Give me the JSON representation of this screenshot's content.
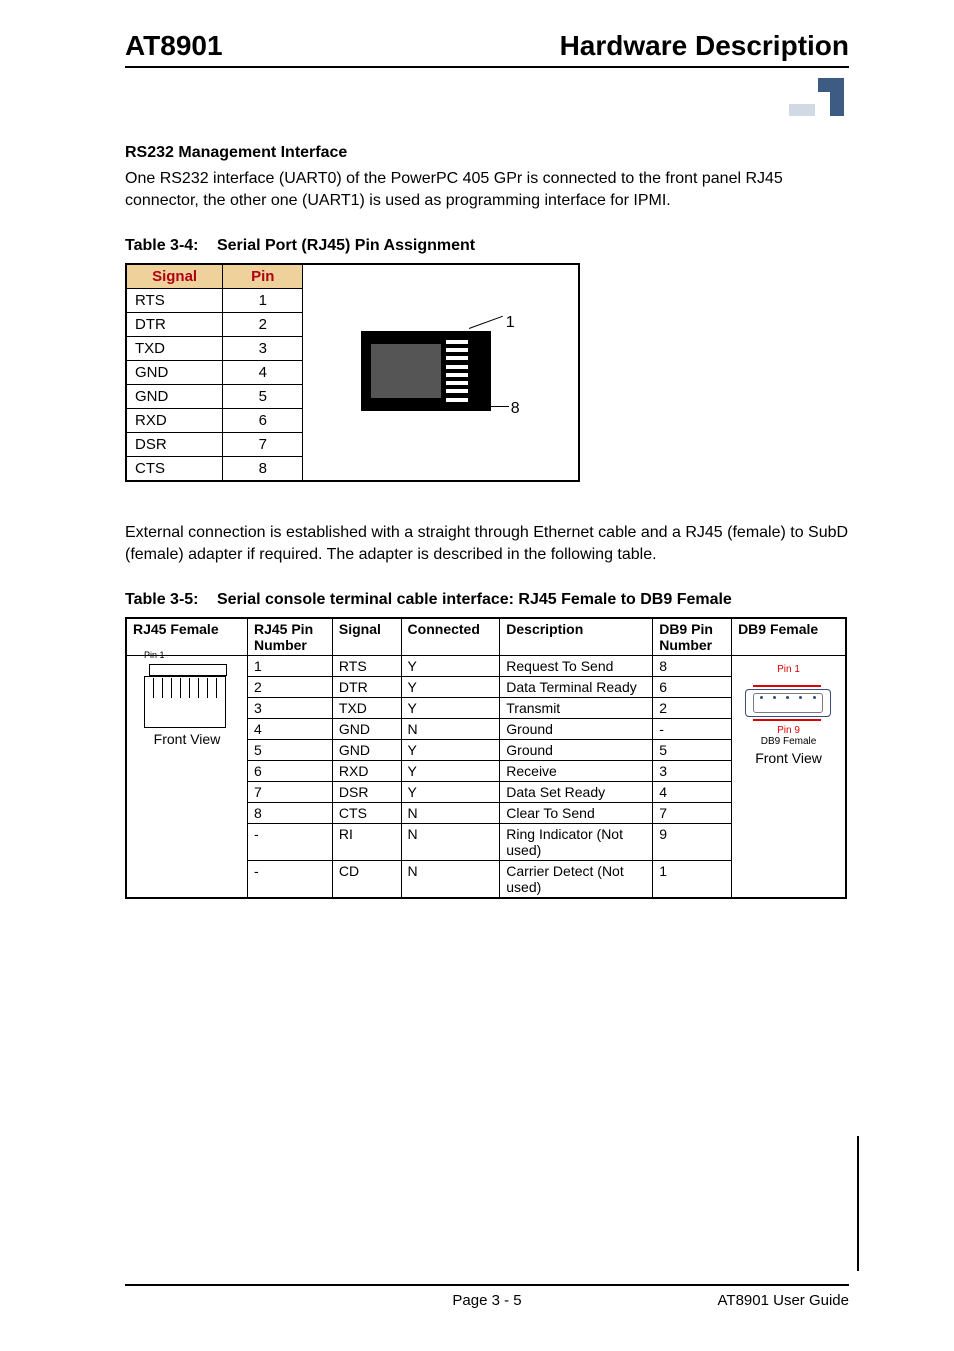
{
  "header": {
    "left": "AT8901",
    "right": "Hardware Description"
  },
  "subhead": "RS232 Management Interface",
  "para1": "One RS232 interface (UART0) of the PowerPC 405 GPr is connected to the front panel RJ45 connector, the other one (UART1) is used as programming interface for IPMI.",
  "table1": {
    "caption_num": "Table 3-4:",
    "caption_title": "Serial Port (RJ45) Pin Assignment",
    "headers": {
      "signal": "Signal",
      "pin": "Pin"
    },
    "rows": [
      {
        "signal": "RTS",
        "pin": "1"
      },
      {
        "signal": "DTR",
        "pin": "2"
      },
      {
        "signal": "TXD",
        "pin": "3"
      },
      {
        "signal": "GND",
        "pin": "4"
      },
      {
        "signal": "GND",
        "pin": "5"
      },
      {
        "signal": "RXD",
        "pin": "6"
      },
      {
        "signal": "DSR",
        "pin": "7"
      },
      {
        "signal": "CTS",
        "pin": "8"
      }
    ],
    "illus": {
      "label_top": "1",
      "label_bottom": "8"
    }
  },
  "para2": "External connection is established with a straight through Ethernet cable and a RJ45 (female) to SubD (female) adapter if required. The adapter is described in the following table.",
  "table2": {
    "caption_num": "Table 3-5:",
    "caption_title": "Serial console terminal cable interface: RJ45 Female to DB9 Female",
    "headers": {
      "c1": "RJ45 Female",
      "c2": "RJ45 Pin Number",
      "c3": "Signal",
      "c4": "Connected",
      "c5": "Description",
      "c6": "DB9 Pin Number",
      "c7": "DB9 Female"
    },
    "rows": [
      {
        "c2": "1",
        "c3": "RTS",
        "c4": "Y",
        "c5": "Request To Send",
        "c6": "8"
      },
      {
        "c2": "2",
        "c3": "DTR",
        "c4": "Y",
        "c5": "Data Terminal Ready",
        "c6": "6"
      },
      {
        "c2": "3",
        "c3": "TXD",
        "c4": "Y",
        "c5": "Transmit",
        "c6": "2"
      },
      {
        "c2": "4",
        "c3": "GND",
        "c4": "N",
        "c5": "Ground",
        "c6": "-"
      },
      {
        "c2": "5",
        "c3": "GND",
        "c4": "Y",
        "c5": "Ground",
        "c6": "5"
      },
      {
        "c2": "6",
        "c3": "RXD",
        "c4": "Y",
        "c5": "Receive",
        "c6": "3"
      },
      {
        "c2": "7",
        "c3": "DSR",
        "c4": "Y",
        "c5": "Data Set Ready",
        "c6": "4"
      },
      {
        "c2": "8",
        "c3": "CTS",
        "c4": "N",
        "c5": "Clear To Send",
        "c6": "7"
      },
      {
        "c2": "-",
        "c3": "RI",
        "c4": "N",
        "c5": "Ring Indicator (Not used)",
        "c6": "9"
      },
      {
        "c2": "-",
        "c3": "CD",
        "c4": "N",
        "c5": "Carrier Detect (Not used)",
        "c6": "1"
      }
    ],
    "left_illus": {
      "pin_label": "Pin 1",
      "view": "Front View"
    },
    "right_illus": {
      "pin1": "Pin 1",
      "pin9": "Pin 9",
      "part": "DB9 Female",
      "view": "Front View"
    }
  },
  "footer": {
    "center": "Page 3 - 5",
    "right": "AT8901 User Guide"
  }
}
